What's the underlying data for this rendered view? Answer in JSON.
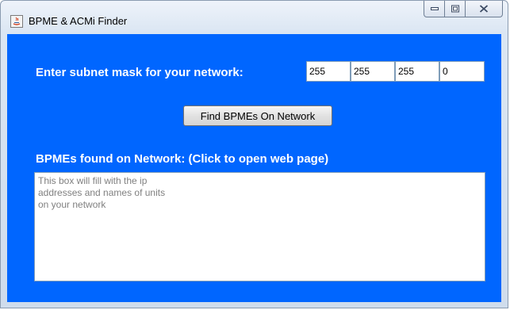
{
  "window": {
    "title": "BPME & ACMi Finder",
    "app_icon": "java-icon",
    "controls": [
      "minimize-icon",
      "maximize-icon",
      "close-icon"
    ]
  },
  "form": {
    "subnet_label": "Enter subnet mask for your network:",
    "subnet_octets": [
      "255",
      "255",
      "255",
      "0"
    ],
    "find_button_label": "Find BPMEs On Network",
    "results_label": "BPMEs found on Network: (Click to open web page)",
    "results_placeholder": "This box will fill with the ip\naddresses and names of units\non your network"
  },
  "colors": {
    "panel_background": "#0066ff",
    "label_text": "#ffffff",
    "placeholder_text": "#808080"
  }
}
